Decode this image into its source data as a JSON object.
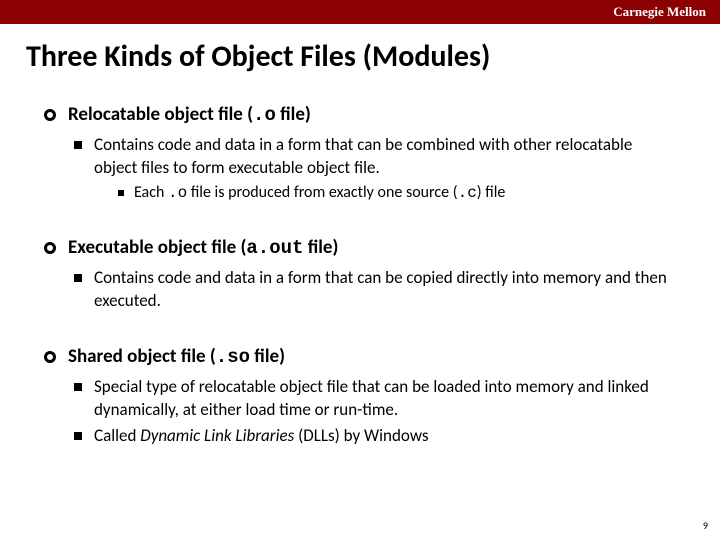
{
  "banner": {
    "org": "Carnegie Mellon"
  },
  "title": "Three Kinds of Object Files (Modules)",
  "sections": [
    {
      "head_a": "Relocatable object file (",
      "head_code": ".o",
      "head_b": " file)",
      "subs": [
        {
          "text": "Contains code and data in a form that can be combined with other relocatable object files to form executable object file.",
          "sub3": {
            "a": "Each ",
            "code1": ".o",
            "b": " file is produced from exactly one source (",
            "code2": ".c",
            "c": ") file"
          }
        }
      ]
    },
    {
      "head_a": "Executable object file (",
      "head_code": "a.out",
      "head_b": " file)",
      "subs": [
        {
          "text": "Contains code and data in a form that can be copied directly into memory and then executed."
        }
      ]
    },
    {
      "head_a": "Shared object file (",
      "head_code": ".so",
      "head_b": "  file)",
      "subs": [
        {
          "text": "Special type of relocatable object file that can be loaded into memory and linked dynamically, at either load time or run-time."
        },
        {
          "rich_a": "Called ",
          "rich_i": "Dynamic Link Libraries",
          "rich_b": " (DLLs) by Windows"
        }
      ]
    }
  ],
  "page": "9"
}
